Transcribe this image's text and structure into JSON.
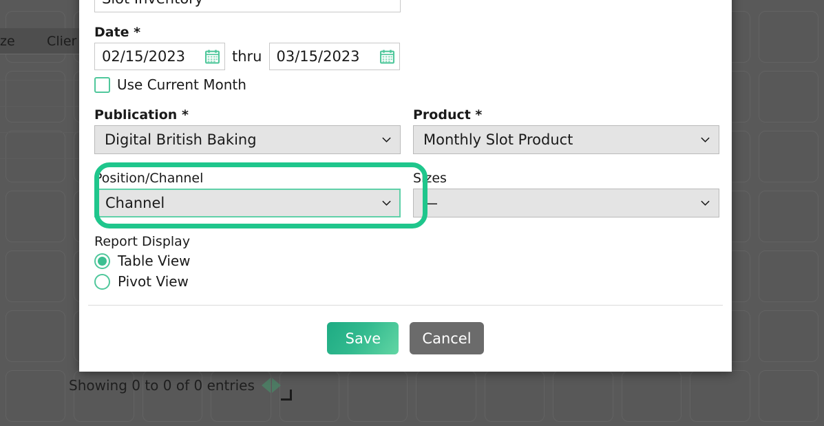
{
  "background": {
    "table_headers": [
      "ze",
      "Clier"
    ],
    "pagination_text": "Showing 0 to 0 of 0 entries",
    "prev_icon": "triangle-left-icon",
    "next_icon": "triangle-right-icon",
    "resize_handle_icon": "resize-handle-icon",
    "overlay_color": "#595959"
  },
  "modal": {
    "slot_inventory": {
      "value": "Slot Inventory"
    },
    "date": {
      "label": "Date *",
      "from_value": "02/15/2023",
      "to_value": "03/15/2023",
      "thru_label": "thru",
      "calendar_icon": "calendar-icon",
      "use_current_month_label": "Use Current Month",
      "use_current_month_checked": false
    },
    "publication": {
      "label": "Publication *",
      "value": "Digital British Baking",
      "chevron_icon": "chevron-down-icon"
    },
    "product": {
      "label": "Product *",
      "value": "Monthly Slot Product",
      "chevron_icon": "chevron-down-icon"
    },
    "position_channel": {
      "label": "Position/Channel",
      "value": "Channel",
      "chevron_icon": "chevron-down-icon",
      "highlighted": true,
      "highlight_color": "#1fc68c"
    },
    "sizes": {
      "label": "Sizes",
      "value": "—",
      "chevron_icon": "chevron-down-icon"
    },
    "report_display": {
      "label": "Report Display",
      "options": [
        {
          "label": "Table View",
          "selected": true
        },
        {
          "label": "Pivot View",
          "selected": false
        }
      ]
    },
    "footer": {
      "save_label": "Save",
      "cancel_label": "Cancel",
      "save_color": "#31b98e",
      "cancel_color": "#6b6b6b"
    }
  }
}
